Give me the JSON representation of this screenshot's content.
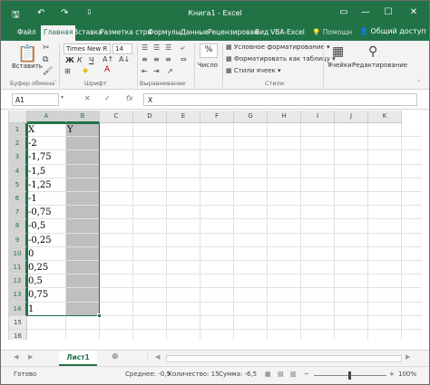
{
  "titlebar": {
    "title": "Книга1 - Excel",
    "save_icon": "🖫",
    "undo_icon": "↶",
    "redo_icon": "↷",
    "customize_icon": "⇩",
    "ribbon_options_icon": "▭",
    "minimize_icon": "—",
    "maximize_icon": "☐",
    "close_icon": "✕"
  },
  "tabs": {
    "items": [
      "Файл",
      "Главная",
      "Вставка",
      "Разметка стра",
      "Формулы",
      "Данные",
      "Рецензирован",
      "Вид",
      "VBA-Excel"
    ],
    "active": "Главная",
    "tell_me": "Помощн",
    "share": "Общий доступ"
  },
  "ribbon": {
    "paste_label": "Вставить",
    "font_name": "Times New R",
    "font_size": "14",
    "bold": "Ж",
    "italic": "К",
    "underline": "Ч",
    "number_label": "Число",
    "number_icon": "%",
    "conditional_formatting": "Условное форматирование",
    "format_as_table": "Форматировать как таблицу",
    "cell_styles": "Стили ячеек",
    "cells_label": "Ячейки",
    "editing_label": "Редактирование",
    "groups": {
      "clipboard": "Буфер обмена",
      "font": "Шрифт",
      "alignment": "Выравнивание",
      "styles": "Стили"
    }
  },
  "formula_bar": {
    "name_box": "A1",
    "cancel": "✕",
    "enter": "✓",
    "fx": "fx",
    "content": "X"
  },
  "grid": {
    "columns": [
      "A",
      "B",
      "C",
      "D",
      "E",
      "F",
      "G",
      "H",
      "I",
      "J",
      "K"
    ],
    "rows": [
      "1",
      "2",
      "3",
      "4",
      "5",
      "6",
      "7",
      "8",
      "9",
      "10",
      "11",
      "12",
      "13",
      "14",
      "15",
      "16",
      "17"
    ],
    "col_a": [
      "X",
      "-2",
      "-1,75",
      "-1,5",
      "-1,25",
      "-1",
      "-0,75",
      "-0,5",
      "-0,25",
      "0",
      "0,25",
      "0,5",
      "0,75",
      "1"
    ],
    "col_b": [
      "Y"
    ]
  },
  "sheets": {
    "active": "Лист1",
    "add": "⊕",
    "prev": "◀",
    "next": "▶"
  },
  "status": {
    "ready": "Готово",
    "average": "Среднее: -0,5",
    "count": "Количество: 15",
    "sum": "Сумма: -6,5",
    "zoom": "100%",
    "minus": "−",
    "plus": "+"
  }
}
